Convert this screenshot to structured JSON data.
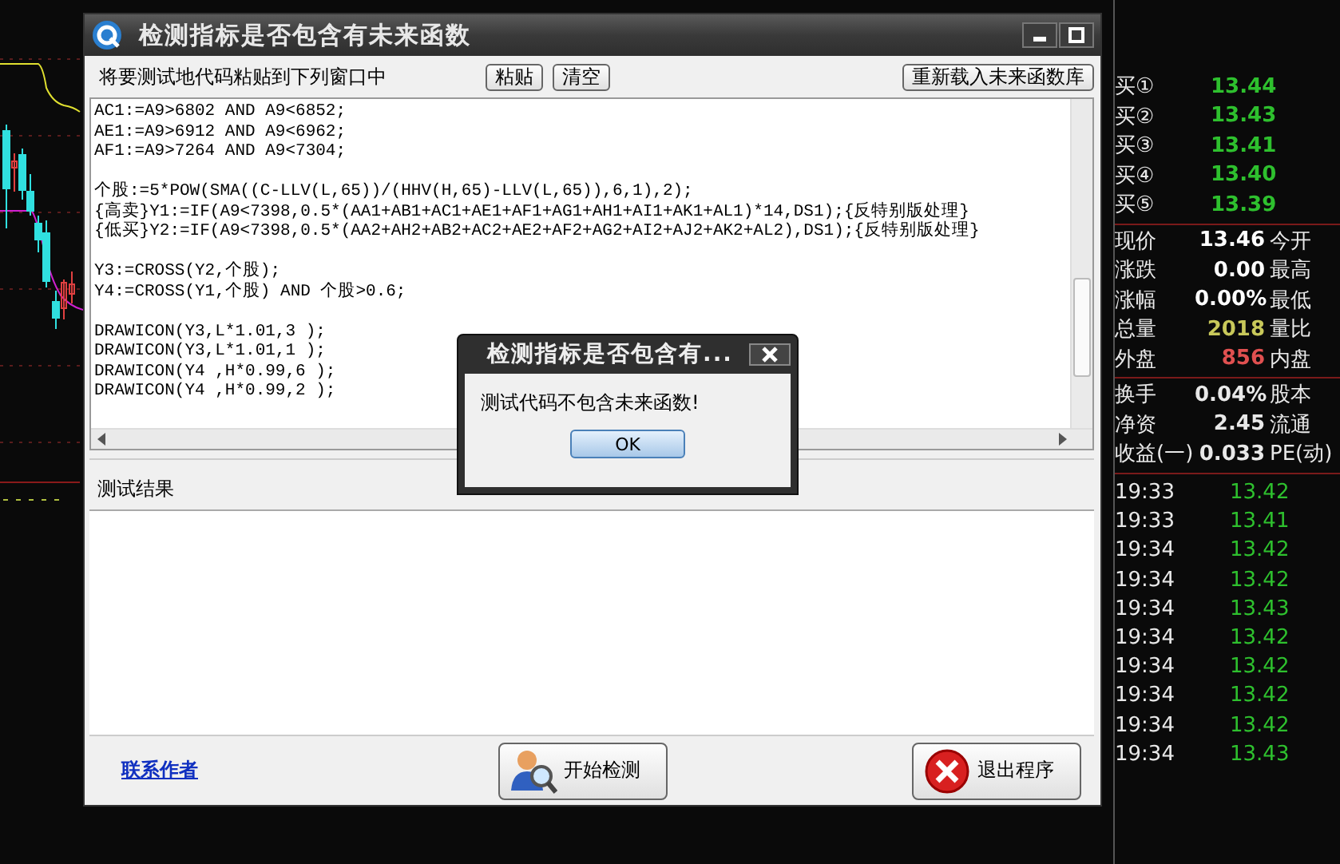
{
  "dialog": {
    "title": "检测指标是否包含有未来函数",
    "toolbar": {
      "instruction": "将要测试地代码粘贴到下列窗口中",
      "buttons": [
        "粘贴",
        "清空"
      ],
      "reload_button": "重新载入未来函数库"
    },
    "code_blocks": [
      [
        "AC1:=A9>6802 AND A9<6852;",
        "AE1:=A9>6912 AND A9<6962;",
        "AF1:=A9>7264 AND A9<7304;"
      ],
      [
        "个股:=5*POW(SMA((C-LLV(L,65))/(HHV(H,65)-LLV(L,65)),6,1),2);",
        "{高卖}Y1:=IF(A9<7398,0.5*(AA1+AB1+AC1+AE1+AF1+AG1+AH1+AI1+AK1+AL1)*14,DS1);{反特别版处理}",
        "{低买}Y2:=IF(A9<7398,0.5*(AA2+AH2+AB2+AC2+AE2+AF2+AG2+AI2+AJ2+AK2+AL2),DS1);{反特别版处理}"
      ],
      [
        "Y3:=CROSS(Y2,个股);",
        "Y4:=CROSS(Y1,个股) AND 个股>0.6;"
      ],
      [
        "DRAWICON(Y3,L*1.01,3 );",
        "DRAWICON(Y3,L*1.01,1 );",
        "DRAWICON(Y4 ,H*0.99,6 );",
        "DRAWICON(Y4 ,H*0.99,2 );"
      ]
    ],
    "result_label": "测试结果",
    "contact_link": "联系作者",
    "start_button": "开始检测",
    "exit_button": "退出程序"
  },
  "message_box": {
    "title": "检测指标是否包含有...",
    "message": "测试代码不包含未来函数!",
    "ok_button": "OK"
  },
  "quote_panel": {
    "bids": [
      {
        "label": "买①",
        "price": "13.44"
      },
      {
        "label": "买②",
        "price": "13.43"
      },
      {
        "label": "买③",
        "price": "13.41"
      },
      {
        "label": "买④",
        "price": "13.40"
      },
      {
        "label": "买⑤",
        "price": "13.39"
      }
    ],
    "stats": [
      {
        "label": "现价",
        "value": "13.46",
        "label_2": "今开",
        "color": "#ffffff"
      },
      {
        "label": "涨跌",
        "value": "0.00",
        "label_2": "最高",
        "color": "#ffffff"
      },
      {
        "label": "涨幅",
        "value": "0.00%",
        "label_2": "最低",
        "color": "#ffffff"
      },
      {
        "label": "总量",
        "value": "2018",
        "label_2": "量比",
        "color": "#c8c85a"
      },
      {
        "label": "外盘",
        "value": "856",
        "label_2": "内盘",
        "color": "#e05050"
      }
    ],
    "shares": [
      {
        "label": "换手",
        "value": "0.04%",
        "label_2": "股本"
      },
      {
        "label": "净资",
        "value": "2.45",
        "label_2": "流通"
      },
      {
        "label": "收益(一)",
        "value": "0.033",
        "label_2": "PE(动)"
      }
    ],
    "ticks": [
      {
        "time": "19:33",
        "price": "13.42"
      },
      {
        "time": "19:33",
        "price": "13.41"
      },
      {
        "time": "19:34",
        "price": "13.42"
      },
      {
        "time": "19:34",
        "price": "13.42"
      },
      {
        "time": "19:34",
        "price": "13.43"
      },
      {
        "time": "19:34",
        "price": "13.42"
      },
      {
        "time": "19:34",
        "price": "13.42"
      },
      {
        "time": "19:34",
        "price": "13.42"
      },
      {
        "time": "19:34",
        "price": "13.42"
      },
      {
        "time": "19:34",
        "price": "13.43"
      }
    ]
  }
}
